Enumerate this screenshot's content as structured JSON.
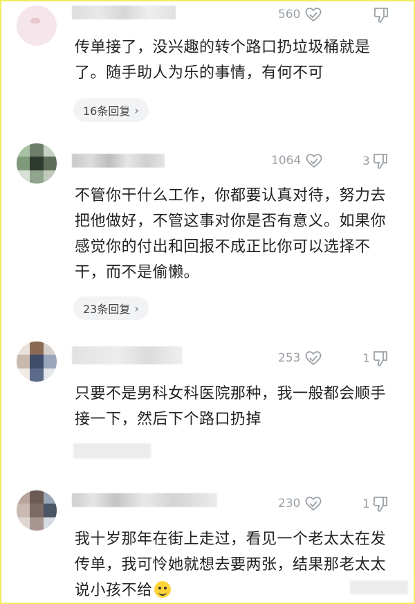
{
  "comments": [
    {
      "text": "传单接了，没兴趣的转个路口扔垃圾桶就是了。随手助人为乐的事情，有何不可",
      "likes": "560",
      "replies": "16条回复"
    },
    {
      "text": "不管你干什么工作，你都要认真对待，努力去把他做好，不管这事对你是否有意义。如果你感觉你的付出和回报不成正比你可以选择不干，而不是偷懒。",
      "likes": "1064",
      "dislikes": "3",
      "replies": "23条回复"
    },
    {
      "text": "只要不是男科女科医院那种，我一般都会顺手接一下，然后下个路口扔掉",
      "likes": "253",
      "dislikes": "1"
    },
    {
      "text": "我十岁那年在街上走过，看见一个老太太在发传单，我可怜她就想去要两张，结果那老太太说小孩不给",
      "likes": "230",
      "dislikes": "1",
      "emoji": "smile-emoji"
    }
  ],
  "colors": {
    "frame": "#f2ea5c",
    "meta_text": "#9aa0a6",
    "body_text": "#222222",
    "reply_pill": "#f2f3f5"
  }
}
